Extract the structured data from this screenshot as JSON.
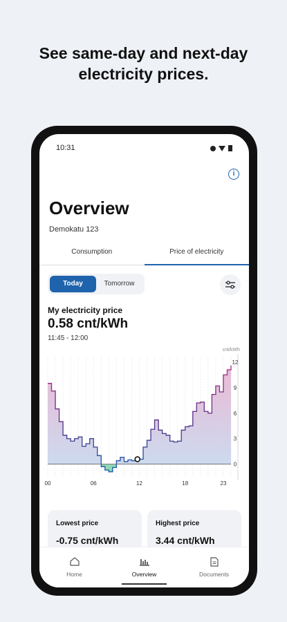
{
  "promo": {
    "line1": "See same-day and next-day",
    "line2": "electricity prices."
  },
  "status": {
    "time": "10:31"
  },
  "header": {
    "title": "Overview",
    "address": "Demokatu 123"
  },
  "tabs": [
    {
      "label": "Consumption",
      "active": false
    },
    {
      "label": "Price of electricity",
      "active": true
    }
  ],
  "day_toggle": {
    "today": "Today",
    "tomorrow": "Tomorrow",
    "selected": "Today"
  },
  "price": {
    "label": "My electricity price",
    "value": "0.58 cnt/kWh",
    "time_range": "11:45 - 12:00"
  },
  "chart_data": {
    "type": "area",
    "ylabel": "cnt/kWh",
    "ylim": [
      -1.5,
      12
    ],
    "yticks": [
      "12",
      "9",
      "6",
      "3",
      "0"
    ],
    "xticks": [
      "00",
      "06",
      "12",
      "18",
      "23"
    ],
    "grid": true,
    "x_hours": [
      0,
      0.5,
      1,
      1.5,
      2,
      2.5,
      3,
      3.5,
      4,
      4.5,
      5,
      5.5,
      6,
      6.5,
      7,
      7.5,
      8,
      8.5,
      9,
      9.5,
      10,
      10.5,
      11,
      11.5,
      12,
      12.5,
      13,
      13.5,
      14,
      14.5,
      15,
      15.5,
      16,
      16.5,
      17,
      17.5,
      18,
      18.5,
      19,
      19.5,
      20,
      20.5,
      21,
      21.5,
      22,
      22.5,
      23,
      23.5,
      24
    ],
    "y": [
      9.5,
      8.6,
      6.5,
      5.0,
      3.4,
      3.0,
      2.7,
      3.0,
      3.2,
      2.1,
      2.4,
      3.0,
      2.0,
      1.0,
      -0.3,
      -0.7,
      -0.9,
      -0.4,
      0.4,
      0.8,
      0.3,
      0.5,
      0.4,
      0.5,
      0.58,
      2.0,
      2.8,
      4.1,
      5.2,
      4.0,
      3.6,
      3.4,
      2.7,
      2.6,
      2.7,
      4.0,
      4.4,
      4.5,
      6.2,
      7.2,
      7.3,
      6.2,
      6.0,
      8.2,
      9.2,
      8.5,
      10.5,
      11.1,
      11.6
    ],
    "marker": {
      "x": 11.75,
      "y": 0.58
    },
    "colors": {
      "line_positive": "#5b3a8c",
      "line_negative": "#2aa16f",
      "fill_top": "#e7b3d0",
      "fill_bottom": "#c5d8ef",
      "fill_negative": "#7fd8a8"
    }
  },
  "stats": {
    "lowest_label": "Lowest price",
    "lowest_value": "-0.75 cnt/kWh",
    "highest_label": "Highest price",
    "highest_value": "3.44 cnt/kWh"
  },
  "nav": [
    {
      "label": "Home",
      "icon": "home-icon",
      "active": false
    },
    {
      "label": "Overview",
      "icon": "bar-chart-icon",
      "active": true
    },
    {
      "label": "Documents",
      "icon": "document-icon",
      "active": false
    }
  ],
  "colors": {
    "accent": "#1f63ad",
    "background": "#eef1f6"
  }
}
